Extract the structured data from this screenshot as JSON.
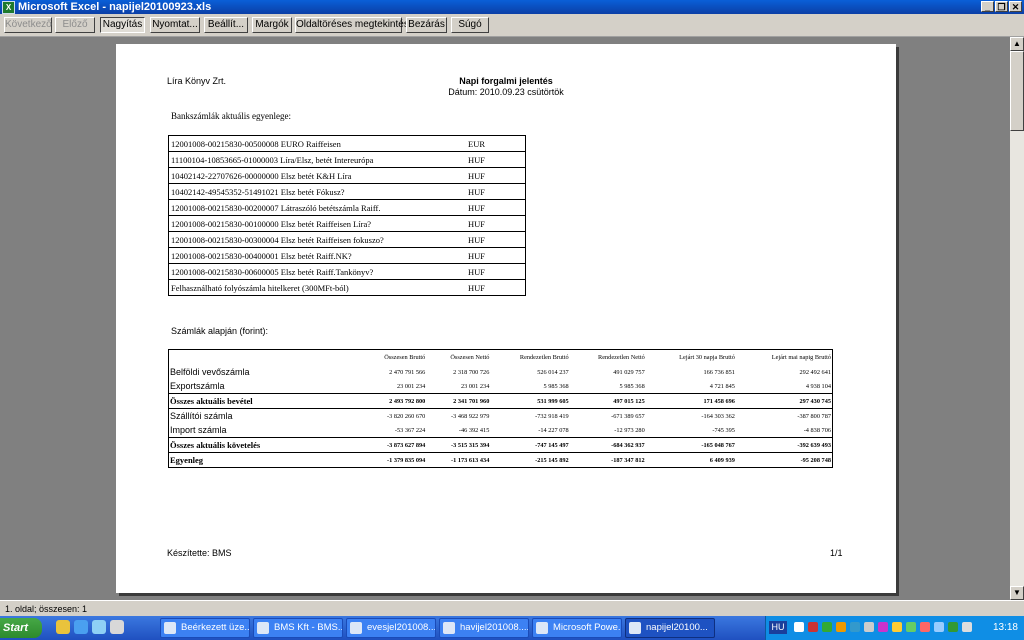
{
  "window": {
    "title": "Microsoft Excel - napijel20100923.xls",
    "app_icon": "X"
  },
  "toolbar": {
    "buttons": [
      "Következő",
      "Előző",
      "Nagyítás",
      "Nyomtat...",
      "Beállít...",
      "Margók",
      "Oldaltöréses megtekintés",
      "Bezárás",
      "Súgó"
    ]
  },
  "page": {
    "company": "Líra Könyv Zrt.",
    "report_title": "Napi forgalmi jelentés",
    "report_date": "Dátum: 2010.09.23 csütörtök",
    "bank_heading": "Bankszámlák aktuális egyenlege:",
    "bank_accounts": [
      {
        "name": "12001008-00215830-00500008 EURO Raiffeisen",
        "currency": "EUR"
      },
      {
        "name": "11100104-10853665-01000003 Líra/Elsz, betét Intereurópa",
        "currency": "HUF"
      },
      {
        "name": "10402142-22707626-00000000 Elsz betét K&H Líra",
        "currency": "HUF"
      },
      {
        "name": "10402142-49545352-51491021 Elsz betét Fókusz?",
        "currency": "HUF"
      },
      {
        "name": "12001008-00215830-00200007 Látraszóló betétszámla Raiff.",
        "currency": "HUF"
      },
      {
        "name": "12001008-00215830-00100000 Elsz betét Raiffeisen Líra?",
        "currency": "HUF"
      },
      {
        "name": "12001008-00215830-00300004 Elsz betét Raiffeisen fokuszo?",
        "currency": "HUF"
      },
      {
        "name": "12001008-00215830-00400001 Elsz betét Raiff.NK?",
        "currency": "HUF"
      },
      {
        "name": "12001008-00215830-00600005 Elsz betét Raiff.Tankönyv?",
        "currency": "HUF"
      },
      {
        "name": "Felhasználható folyószámla hitelkeret (300MFt-ból)",
        "currency": "HUF"
      }
    ],
    "accounts_heading": "Számlák alapján (forint):",
    "columns": [
      "Összesen Bruttó",
      "Összesen Nettó",
      "Rendezetlen Bruttó",
      "Rendezetlen Nettó",
      "Lejárt 30 napja Bruttó",
      "Lejárt mai napig Bruttó"
    ],
    "rows": [
      {
        "label": "Belföldi vevőszámla",
        "values": [
          "2 470 791 566",
          "2 318 700 726",
          "526 014 237",
          "491 029 757",
          "166 736 851",
          "292 492 641"
        ]
      },
      {
        "label": "Exportszámla",
        "values": [
          "23 001 234",
          "23 001 234",
          "5 985 368",
          "5 985 368",
          "4 721 845",
          "4 938 104"
        ]
      },
      {
        "label": "Összes aktuális bevétel",
        "values": [
          "2 493 792 800",
          "2 341 701 960",
          "531 999 605",
          "497 015 125",
          "171 458 696",
          "297 430 745"
        ],
        "bold": true
      },
      {
        "label": "Szállítói számla",
        "values": [
          "-3 820 260 670",
          "-3 468 922 979",
          "-732 918 419",
          "-671 389 657",
          "-164 303 362",
          "-387 800 787"
        ]
      },
      {
        "label": "Import számla",
        "values": [
          "-53 367 224",
          "-46 392 415",
          "-14 227 078",
          "-12 973 280",
          "-745 395",
          "-4 838 706"
        ]
      },
      {
        "label": "Összes aktuális követelés",
        "values": [
          "-3 873 627 894",
          "-3 515 315 394",
          "-747 145 497",
          "-684 362 937",
          "-165 048 767",
          "-392 639 493"
        ],
        "bold": true
      },
      {
        "label": "Egyenleg",
        "values": [
          "-1 379 835 094",
          "-1 173 613 434",
          "-215 145 892",
          "-187 347 812",
          "6 409 939",
          "-95 208 748"
        ],
        "bold": true
      }
    ],
    "footer_left": "Készítette: BMS",
    "footer_right": "1/1"
  },
  "statusbar": {
    "text": "1. oldal; összesen: 1"
  },
  "taskbar": {
    "start": "Start",
    "tasks": [
      "Beérkezett üze...",
      "BMS Kft - BMS...",
      "evesjel201008...",
      "havijel201008....",
      "Microsoft Powe...",
      "napijel20100..."
    ],
    "lang": "HU",
    "clock": "13:18"
  }
}
